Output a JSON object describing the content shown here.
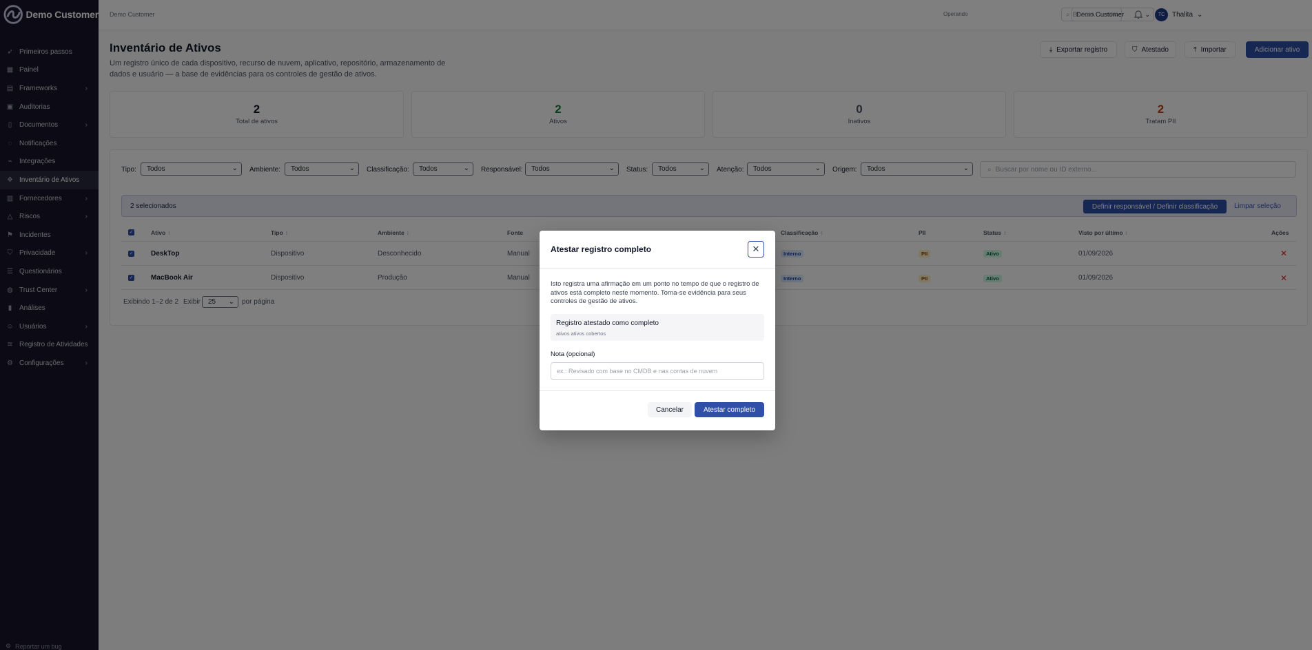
{
  "app": {
    "brand": "Demo Customer"
  },
  "sidebar": {
    "items": [
      {
        "label": "Primeiros passos",
        "icon": "rocket-icon",
        "chevron": false,
        "active": false
      },
      {
        "label": "Painel",
        "icon": "dashboard-icon",
        "chevron": false,
        "active": false
      },
      {
        "label": "Frameworks",
        "icon": "book-icon",
        "chevron": true,
        "active": false
      },
      {
        "label": "Auditorias",
        "icon": "clipboard-icon",
        "chevron": false,
        "active": false
      },
      {
        "label": "Documentos",
        "icon": "document-icon",
        "chevron": true,
        "active": false
      },
      {
        "label": "Notificações",
        "icon": "bell-icon",
        "chevron": false,
        "active": false
      },
      {
        "label": "Integrações",
        "icon": "plug-icon",
        "chevron": false,
        "active": false
      },
      {
        "label": "Inventário de Ativos",
        "icon": "boxes-icon",
        "chevron": false,
        "active": true
      },
      {
        "label": "Fornecedores",
        "icon": "building-icon",
        "chevron": true,
        "active": false
      },
      {
        "label": "Riscos",
        "icon": "alert-icon",
        "chevron": true,
        "active": false
      },
      {
        "label": "Incidentes",
        "icon": "flag-icon",
        "chevron": false,
        "active": false
      },
      {
        "label": "Privacidade",
        "icon": "shield-icon",
        "chevron": true,
        "active": false
      },
      {
        "label": "Questionários",
        "icon": "list-icon",
        "chevron": false,
        "active": false
      },
      {
        "label": "Trust Center",
        "icon": "globe-icon",
        "chevron": true,
        "active": false
      },
      {
        "label": "Análises",
        "icon": "chart-icon",
        "chevron": false,
        "active": false
      },
      {
        "label": "Usuários",
        "icon": "users-icon",
        "chevron": true,
        "active": false
      },
      {
        "label": "Registro de Atividades",
        "icon": "activity-icon",
        "chevron": false,
        "active": false
      },
      {
        "label": "Configurações",
        "icon": "gear-icon",
        "chevron": true,
        "active": false
      }
    ],
    "bug_label": "Reportar um bug"
  },
  "topbar": {
    "breadcrumb": "Demo Customer",
    "operando_label": "Operando",
    "operando_value": "Demo Customer",
    "search_placeholder": "Buscar...",
    "search_kbd": "⌘K",
    "user_initials": "TC",
    "user_name": "Thalita"
  },
  "header": {
    "title": "Inventário de Ativos",
    "description": "Um registro único de cada dispositivo, recurso de nuvem, aplicativo, repositório, armazenamento de dados e usuário — a base de evidências para os controles de gestão de ativos.",
    "btn_export": "Exportar registro",
    "btn_attested": "Atestado",
    "btn_import": "Importar",
    "btn_add": "Adicionar ativo"
  },
  "stats": [
    {
      "value": "2",
      "label": "Total de ativos",
      "color": "#111827"
    },
    {
      "value": "2",
      "label": "Ativos",
      "color": "#15803d"
    },
    {
      "value": "0",
      "label": "Inativos",
      "color": "#4b5563"
    },
    {
      "value": "2",
      "label": "Tratam PII",
      "color": "#c2410c"
    }
  ],
  "filters": {
    "tipo_label": "Tipo:",
    "tipo": "Todos",
    "ambiente_label": "Ambiente:",
    "ambiente": "Todos",
    "classificacao_label": "Classificação:",
    "classificacao": "Todos",
    "responsavel_label": "Responsável:",
    "responsavel": "Todos",
    "status_label": "Status:",
    "status": "Todos",
    "atencao_label": "Atenção:",
    "atencao": "Todos",
    "origem_label": "Origem:",
    "origem": "Todos",
    "search_placeholder": "Buscar por nome ou ID externo..."
  },
  "selection": {
    "count": "2 selecionados",
    "assign": "Definir responsável / Definir classificação",
    "clear": "Limpar seleção"
  },
  "table": {
    "headers": {
      "ativo": "Ativo",
      "tipo": "Tipo",
      "ambiente": "Ambiente",
      "fonte": "Fonte",
      "classificacao": "Classificação",
      "pii": "PII",
      "status": "Status",
      "visto": "Visto por último",
      "acoes": "Ações"
    },
    "rows": [
      {
        "ativo": "DeskTop",
        "tipo": "Dispositivo",
        "ambiente": "Desconhecido",
        "fonte": "Manual",
        "classificacao": "Interno",
        "pii": "PII",
        "status": "Ativo",
        "visto": "01/09/2026"
      },
      {
        "ativo": "MacBook Air",
        "tipo": "Dispositivo",
        "ambiente": "Produção",
        "fonte": "Manual",
        "classificacao": "Interno",
        "pii": "PII",
        "status": "Ativo",
        "visto": "01/09/2026"
      }
    ],
    "pager_text": "Exibindo 1–2 de 2",
    "show_label": "Exibir",
    "page_size": "25",
    "per_page": "por página"
  },
  "modal": {
    "title": "Atestar registro completo",
    "description": "Isto registra uma afirmação em um ponto no tempo de que o registro de ativos está completo neste momento. Torna-se evidência para seus controles de gestão de ativos.",
    "box_title": "Registro atestado como completo",
    "box_sub": "ativos ativos cobertos",
    "note_label": "Nota (opcional)",
    "note_placeholder": "ex.: Revisado com base no CMDB e nas contas de nuvem",
    "cancel": "Cancelar",
    "confirm": "Atestar completo"
  },
  "colors": {
    "primary": "#2f4fa8",
    "sidebar": "#18172a"
  }
}
